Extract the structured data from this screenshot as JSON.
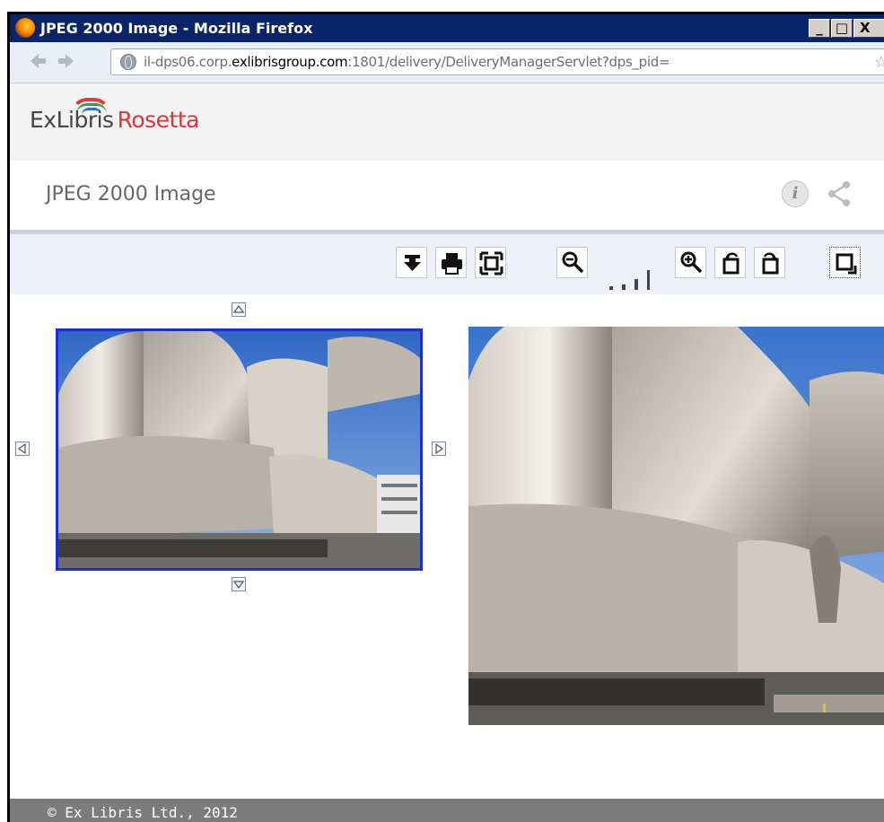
{
  "window": {
    "title": "JPEG 2000 Image - Mozilla Firefox",
    "controls": {
      "minimize": "_",
      "maximize": "□",
      "close": "X"
    }
  },
  "navbar": {
    "url": {
      "prefix": "il-dps06.corp.",
      "domain": "exlibrisgroup.com",
      "suffix": ":1801/delivery/DeliveryManagerServlet?dps_pid="
    }
  },
  "brand": {
    "name_part1": "ExLibris",
    "name_part2": "Rosetta",
    "colors": {
      "rosetta": "#d9373a",
      "exlibris": "#444444"
    }
  },
  "header": {
    "title": "JPEG 2000 Image"
  },
  "toolbar": {
    "buttons": [
      "download-icon",
      "print-icon",
      "fit-to-screen-icon",
      "zoom-out-icon",
      "zoom-in-icon",
      "rotate-left-icon",
      "rotate-right-icon",
      "full-size-icon"
    ],
    "zoom_level_bars": 4
  },
  "viewer": {
    "accent": "#1d2ed1"
  },
  "footer": {
    "copyright": "© Ex Libris Ltd., 2012"
  }
}
